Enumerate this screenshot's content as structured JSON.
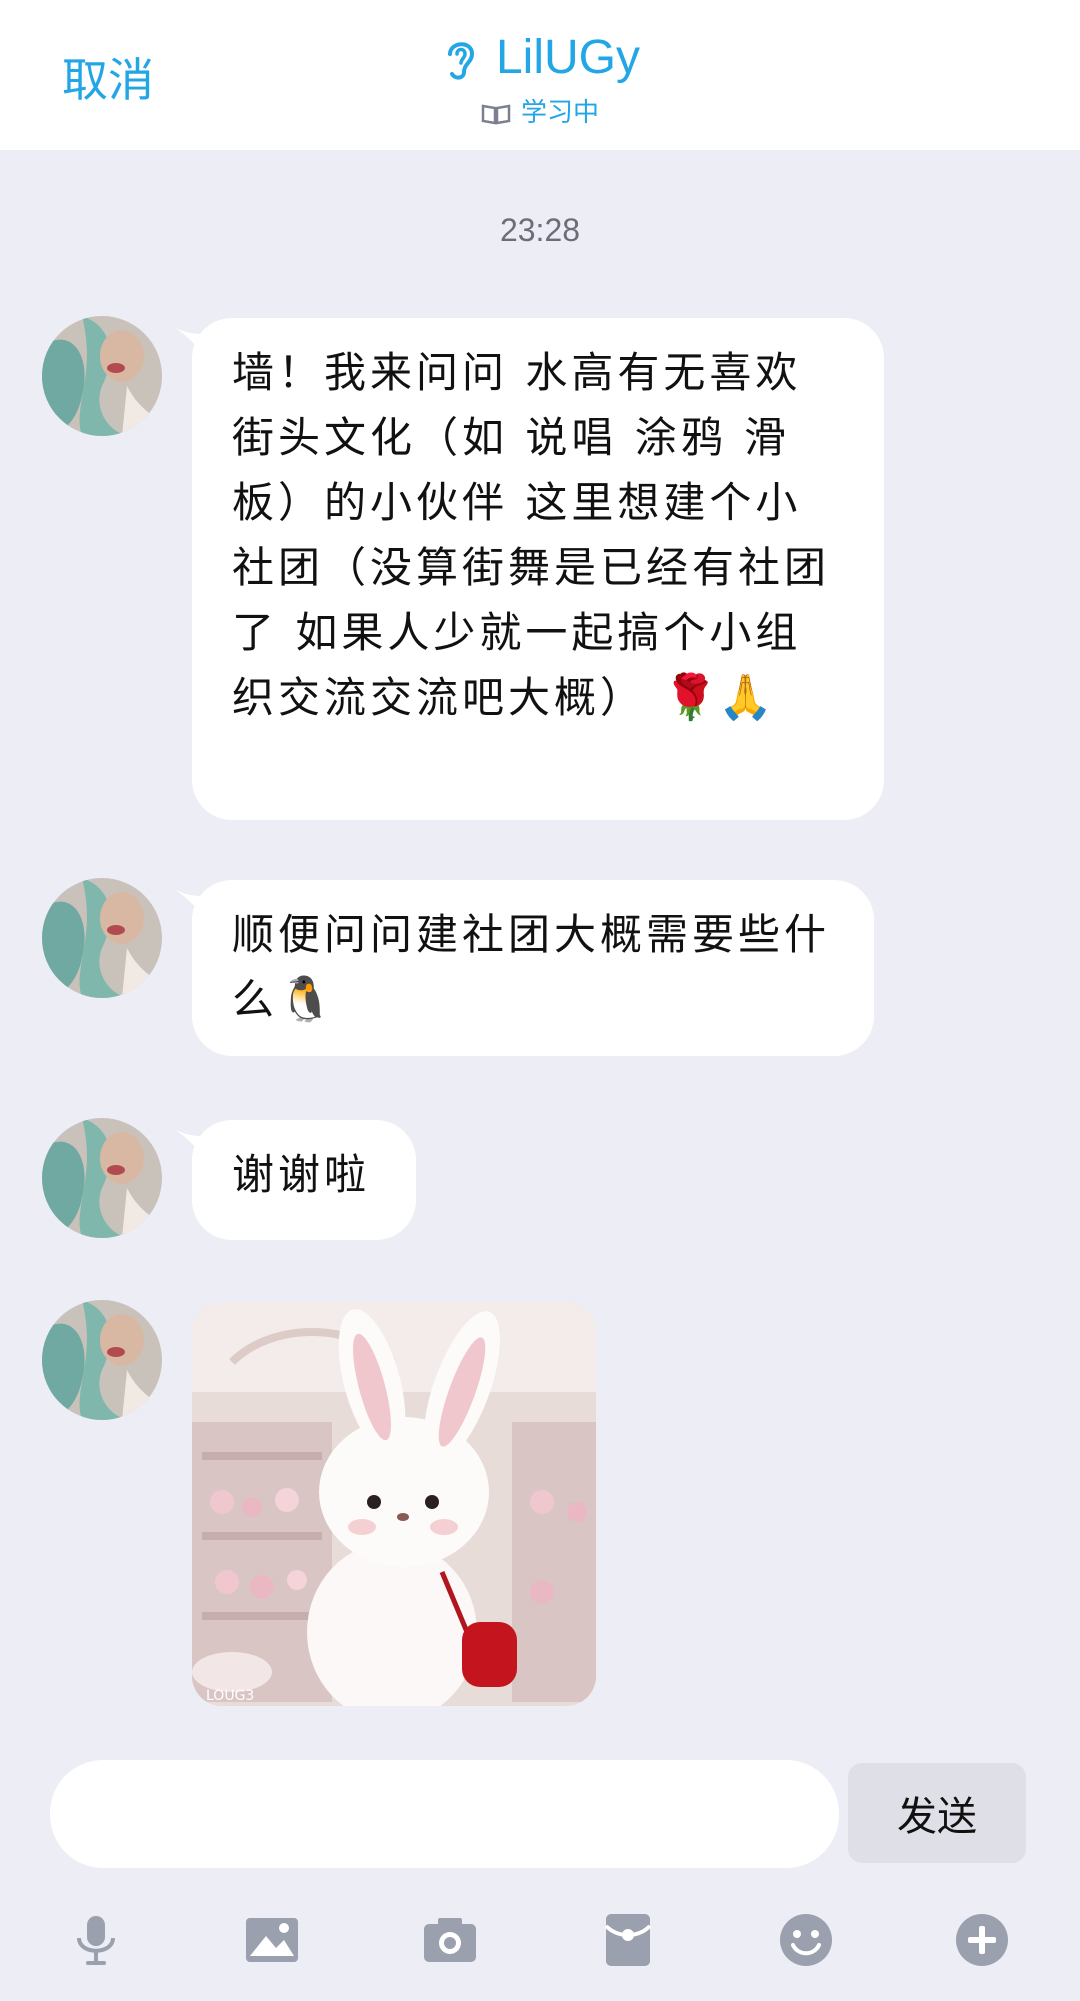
{
  "header": {
    "cancel_label": "取消",
    "title": "LilUGy",
    "status": "学习中"
  },
  "timestamp": "23:28",
  "messages": [
    {
      "text": "墙！我来问问 水高有无喜欢街头文化（如 说唱 涂鸦 滑板）的小伙伴 这里想建个小社团（没算街舞是已经有社团了 如果人少就一起搞个小组织交流交流吧大概）",
      "emojis": "🌹🙏"
    },
    {
      "text": "顺便问问建社团大概需要些什么",
      "emojis": "🐧"
    },
    {
      "text": "谢谢啦",
      "emojis": ""
    }
  ],
  "input": {
    "placeholder": "",
    "value": ""
  },
  "send_label": "发送",
  "toolbar": [
    "mic-icon",
    "image-icon",
    "camera-icon",
    "red-packet-icon",
    "emoji-icon",
    "plus-icon"
  ],
  "colors": {
    "accent": "#22a6e6",
    "background": "#ededf6",
    "bubble": "#ffffff"
  }
}
